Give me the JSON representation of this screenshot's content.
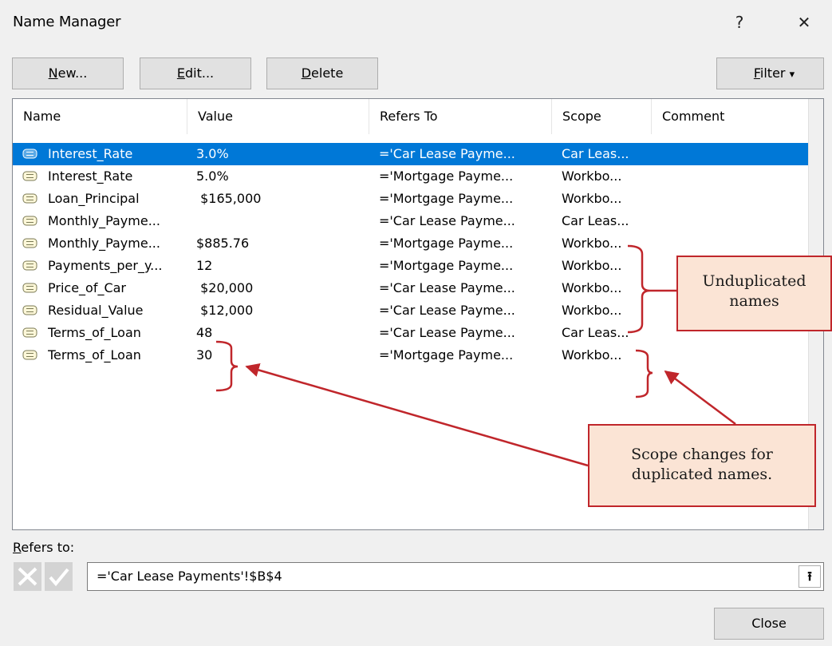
{
  "window": {
    "title": "Name Manager",
    "help_glyph": "?",
    "close_glyph": "✕"
  },
  "toolbar": {
    "new": {
      "u": "N",
      "rest": "ew..."
    },
    "edit": {
      "u": "E",
      "rest": "dit..."
    },
    "delete": {
      "u": "D",
      "rest": "elete"
    },
    "filter": {
      "u": "F",
      "rest": "ilter",
      "arrow": "▾"
    }
  },
  "list": {
    "columns": [
      "Name",
      "Value",
      "Refers To",
      "Scope",
      "Comment"
    ],
    "rows": [
      {
        "name": "Interest_Rate",
        "value": "3.0%",
        "refers": "='Car Lease Payme...",
        "scope": "Car Leas...",
        "comment": "",
        "selected": true
      },
      {
        "name": "Interest_Rate",
        "value": "5.0%",
        "refers": "='Mortgage Payme...",
        "scope": "Workbo...",
        "comment": ""
      },
      {
        "name": "Loan_Principal",
        "value": " $165,000",
        "refers": "='Mortgage Payme...",
        "scope": "Workbo...",
        "comment": ""
      },
      {
        "name": "Monthly_Payme...",
        "value": "",
        "refers": "='Car Lease Payme...",
        "scope": "Car Leas...",
        "comment": ""
      },
      {
        "name": "Monthly_Payme...",
        "value": "$885.76",
        "refers": "='Mortgage Payme...",
        "scope": "Workbo...",
        "comment": ""
      },
      {
        "name": "Payments_per_y...",
        "value": "12",
        "refers": "='Mortgage Payme...",
        "scope": "Workbo...",
        "comment": ""
      },
      {
        "name": "Price_of_Car",
        "value": " $20,000",
        "refers": "='Car Lease Payme...",
        "scope": "Workbo...",
        "comment": ""
      },
      {
        "name": "Residual_Value",
        "value": " $12,000",
        "refers": "='Car Lease Payme...",
        "scope": "Workbo...",
        "comment": ""
      },
      {
        "name": "Terms_of_Loan",
        "value": "48",
        "refers": "='Car Lease Payme...",
        "scope": "Car Leas...",
        "comment": ""
      },
      {
        "name": "Terms_of_Loan",
        "value": "30",
        "refers": "='Mortgage Payme...",
        "scope": "Workbo...",
        "comment": ""
      }
    ]
  },
  "annotations": {
    "unduplicated": [
      "Unduplicated",
      "names"
    ],
    "scope_changes": [
      "Scope changes for",
      "duplicated names."
    ]
  },
  "refers_to": {
    "label_u": "R",
    "label_rest": "efers to:",
    "value": "='Car Lease Payments'!$B$4",
    "collapse_glyph": "⭱"
  },
  "footer": {
    "close": "Close"
  },
  "colors": {
    "selection": "#0078d7",
    "annotation_red": "#c0262b",
    "callout_fill": "#fbe4d5"
  }
}
